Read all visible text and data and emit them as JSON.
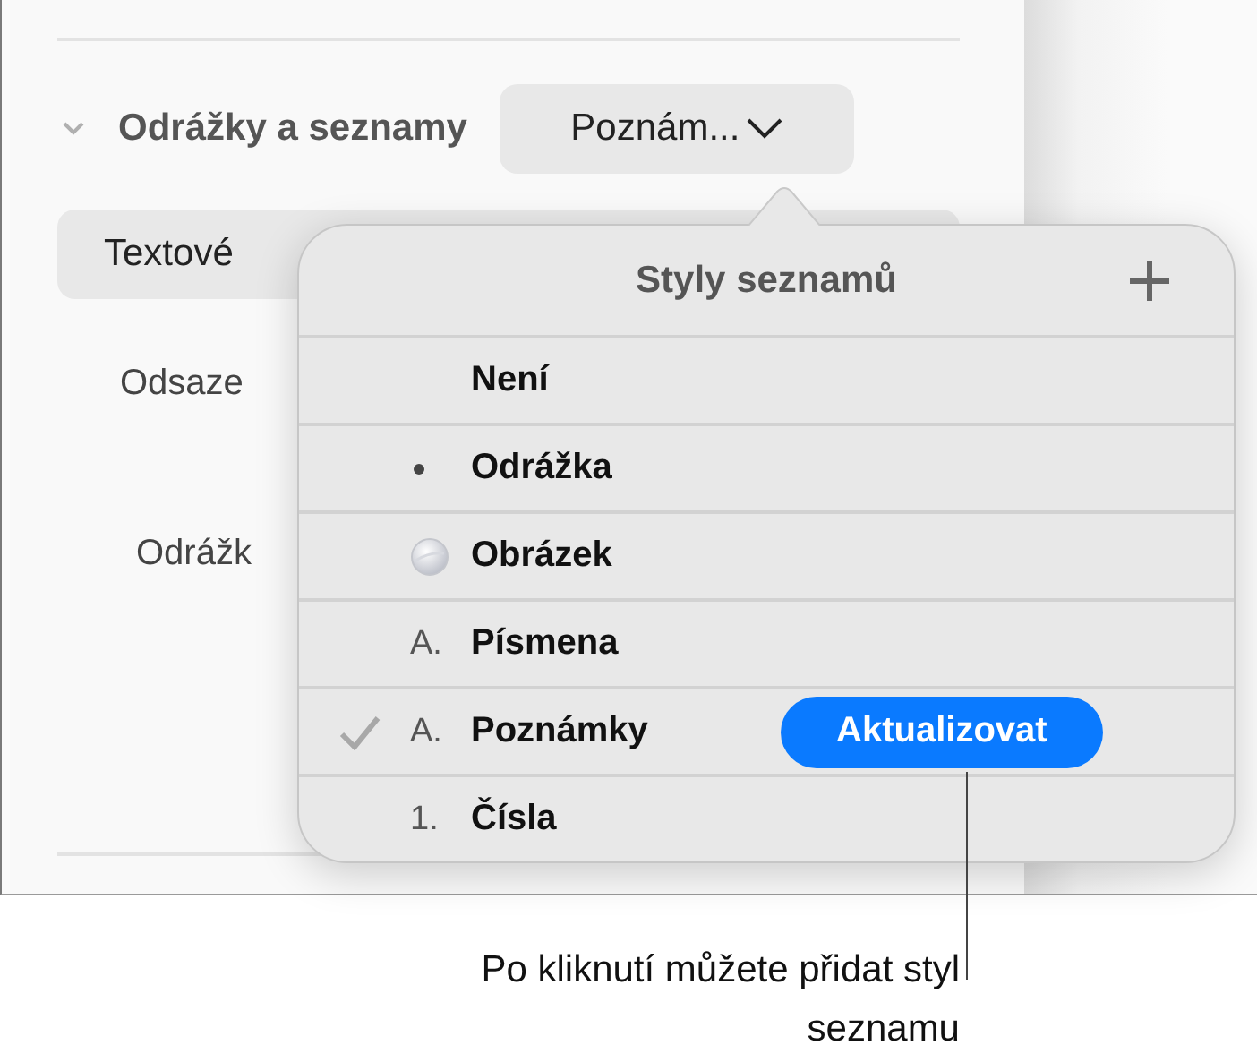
{
  "section": {
    "title": "Odrážky a seznamy",
    "expanded": true,
    "style_popup": "Poznám..."
  },
  "sidebar_rows": [
    {
      "kind": "field",
      "label": "Textové"
    },
    {
      "kind": "label",
      "label": "Odsaze"
    },
    {
      "kind": "label",
      "label": "Odrážk"
    }
  ],
  "popover": {
    "title": "Styly seznamů",
    "items": [
      {
        "label": "Není",
        "kind": "none",
        "selected": false
      },
      {
        "label": "Odrážka",
        "kind": "bullet",
        "selected": false
      },
      {
        "label": "Obrázek",
        "kind": "image",
        "selected": false
      },
      {
        "label": "Písmena",
        "kind": "text",
        "marker": "A.",
        "selected": false
      },
      {
        "label": "Poznámky",
        "kind": "text",
        "marker": "A.",
        "selected": true,
        "action": "Aktualizovat"
      },
      {
        "label": "Čísla",
        "kind": "text",
        "marker": "1.",
        "selected": false
      }
    ]
  },
  "callout": {
    "text": "Po kliknutí můžete přidat styl seznamu"
  }
}
